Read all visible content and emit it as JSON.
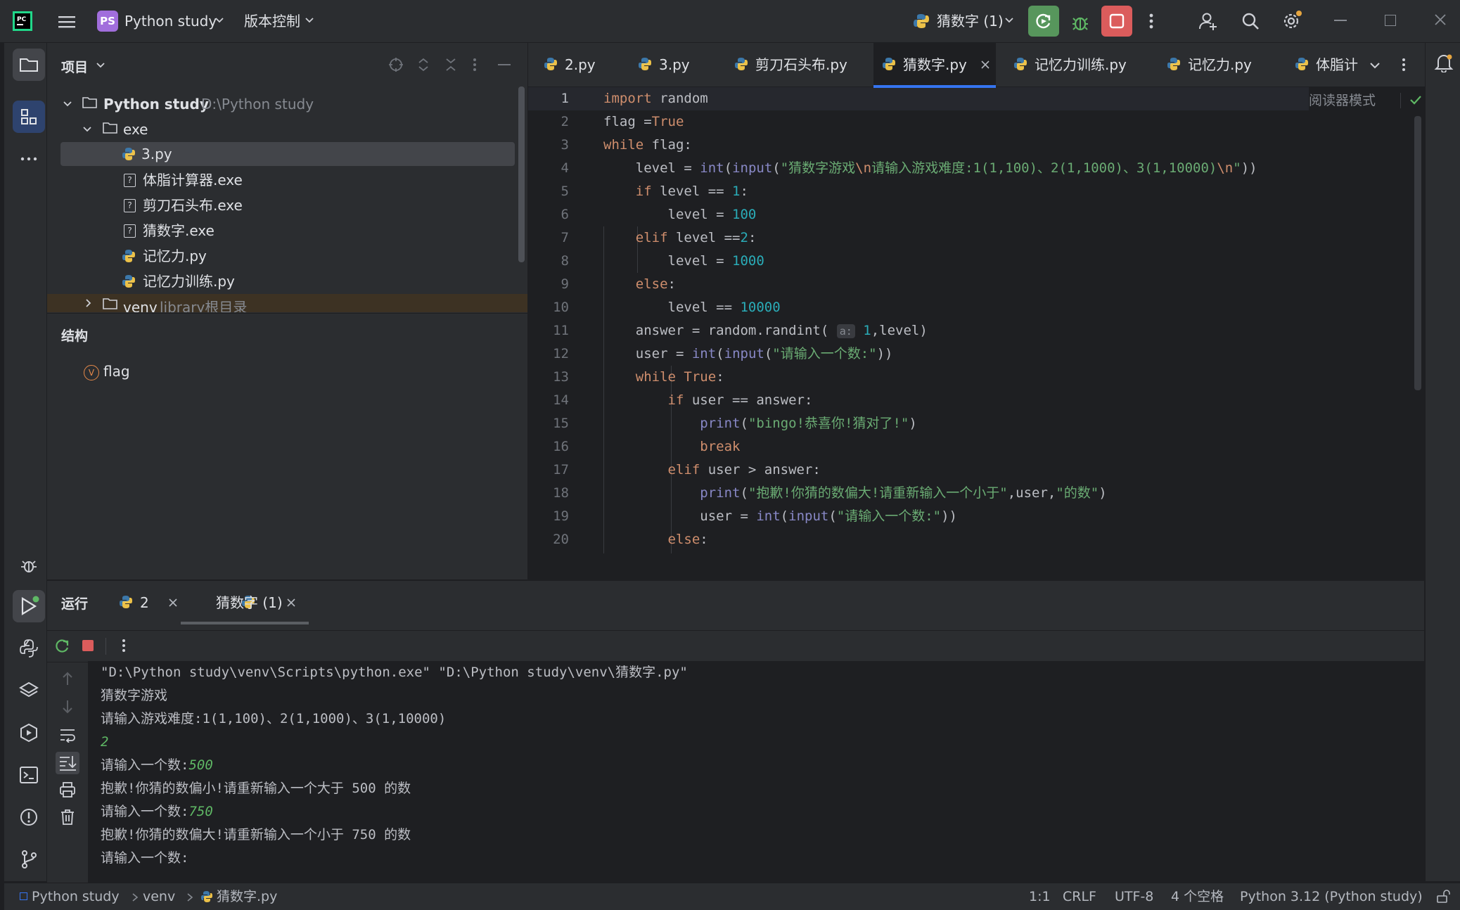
{
  "titlebar": {
    "project_badge": "PS",
    "project_name": "Python study",
    "vcs_label": "版本控制",
    "run_config": "猜数字 (1)"
  },
  "project_panel": {
    "title": "项目",
    "tree": [
      {
        "label": "Python study",
        "path": "D:\\Python study",
        "type": "folder",
        "expanded": true
      },
      {
        "label": "exe",
        "type": "folder",
        "expanded": true
      },
      {
        "label": "3.py",
        "type": "python",
        "selected": true
      },
      {
        "label": "体脂计算器.exe",
        "type": "unknown"
      },
      {
        "label": "剪刀石头布.exe",
        "type": "unknown"
      },
      {
        "label": "猜数字.exe",
        "type": "unknown"
      },
      {
        "label": "记忆力.py",
        "type": "python"
      },
      {
        "label": "记忆力训练.py",
        "type": "python"
      },
      {
        "label": "venv",
        "path": "library根目录",
        "type": "folder",
        "expanded": false
      }
    ]
  },
  "structure_panel": {
    "title": "结构",
    "items": [
      {
        "badge": "V",
        "label": "flag"
      }
    ]
  },
  "editor": {
    "tabs": [
      {
        "label": "2.py"
      },
      {
        "label": "3.py"
      },
      {
        "label": "剪刀石头布.py"
      },
      {
        "label": "猜数字.py",
        "active": true
      },
      {
        "label": "记忆力训练.py"
      },
      {
        "label": "记忆力.py"
      },
      {
        "label": "体脂计"
      }
    ],
    "reader_mode": "阅读器模式",
    "lines": [
      "1",
      "2",
      "3",
      "4",
      "5",
      "6",
      "7",
      "8",
      "9",
      "10",
      "11",
      "12",
      "13",
      "14",
      "15",
      "16",
      "17",
      "18",
      "19",
      "20"
    ]
  },
  "run_panel": {
    "title": "运行",
    "tabs": [
      {
        "label": "2"
      },
      {
        "label": "猜数字 (1)",
        "active": true
      }
    ],
    "console": [
      {
        "text": "\"D:\\Python study\\venv\\Scripts\\python.exe\" \"D:\\Python study\\venv\\猜数字.py\""
      },
      {
        "text": "猜数字游戏"
      },
      {
        "text": "请输入游戏难度:1(1,100)、2(1,1000)、3(1,10000)"
      },
      {
        "input": "2"
      },
      {
        "text": "请输入一个数:",
        "input": "500"
      },
      {
        "text": "抱歉!你猜的数偏小!请重新输入一个大于 500 的数"
      },
      {
        "text": "请输入一个数:",
        "input": "750"
      },
      {
        "text": "抱歉!你猜的数偏大!请重新输入一个小于 750 的数"
      },
      {
        "text": "请输入一个数:"
      }
    ]
  },
  "statusbar": {
    "breadcrumb": [
      "Python study",
      "venv",
      "猜数字.py"
    ],
    "position": "1:1",
    "line_sep": "CRLF",
    "encoding": "UTF-8",
    "indent": "4 个空格",
    "interpreter": "Python 3.12 (Python study)"
  },
  "colors": {
    "run_green": "#57965c",
    "stop_red": "#db5c5c",
    "accent": "#3574f0"
  }
}
